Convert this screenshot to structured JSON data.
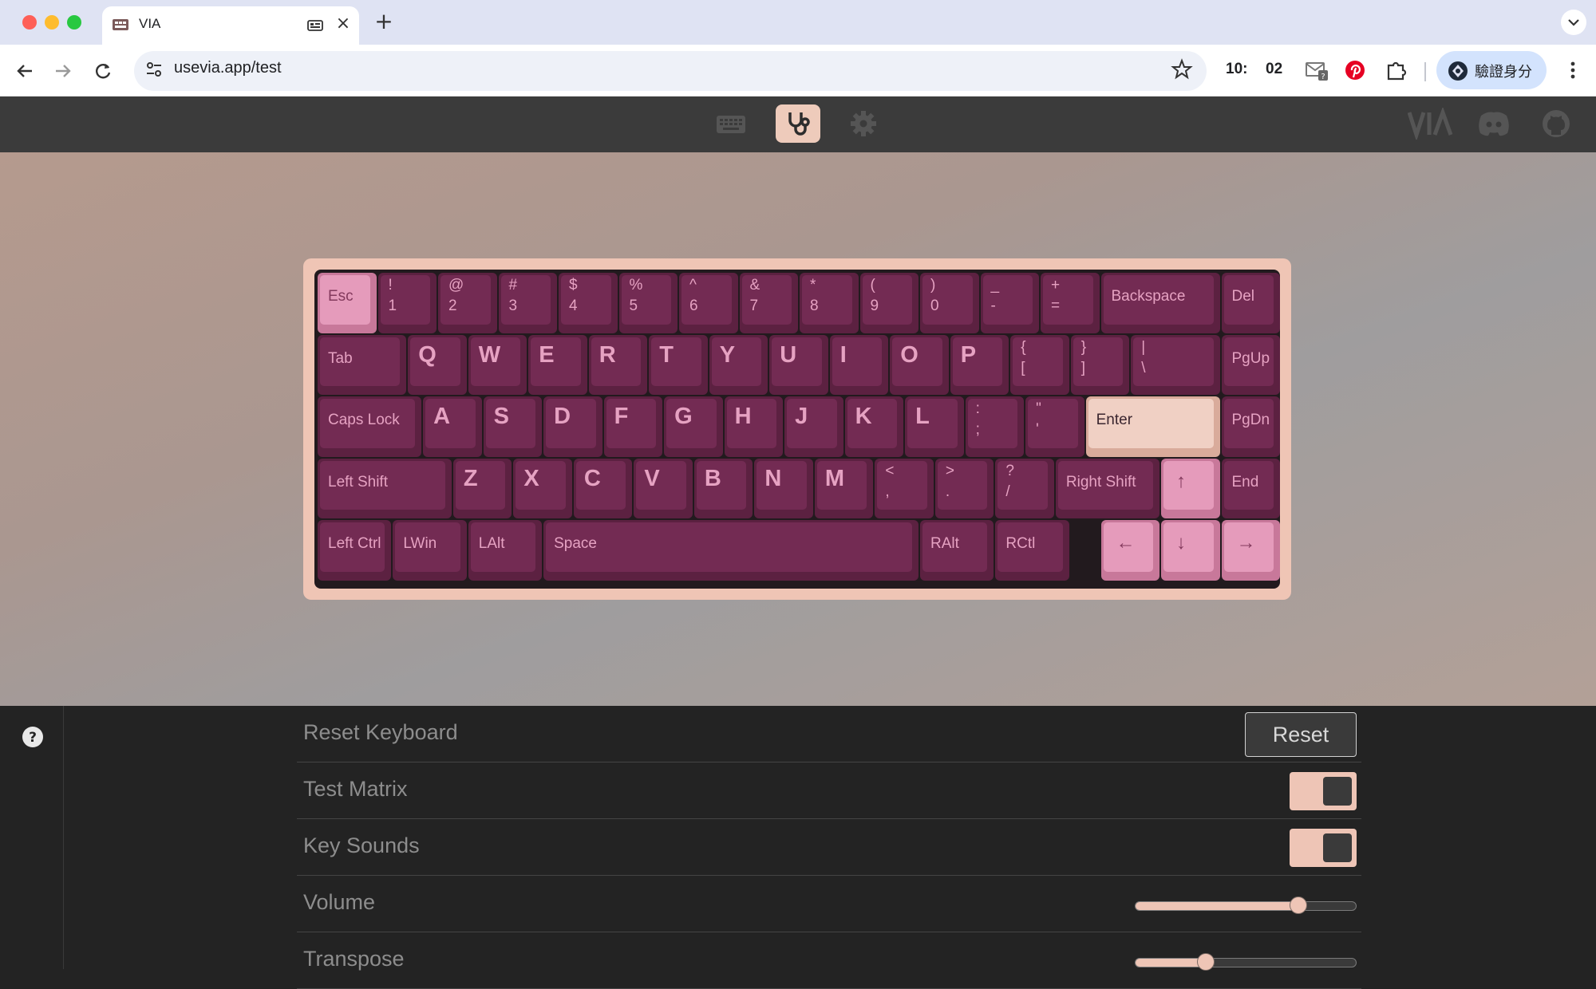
{
  "browser": {
    "tab_title": "VIA",
    "url": "usevia.app/test",
    "clock_hours": "10:",
    "clock_minutes": "02",
    "profile_label": "驗證身分"
  },
  "app": {
    "nav": [
      {
        "name": "configure-keyboard-icon",
        "active": false
      },
      {
        "name": "test-stethoscope-icon",
        "active": true
      },
      {
        "name": "settings-gear-icon",
        "active": false
      }
    ],
    "right_icons": [
      "via-logo",
      "discord-icon",
      "github-icon"
    ]
  },
  "keyboard": {
    "colors": {
      "case": "#efc5b5",
      "key_dark": "#732b53",
      "key_pink": "#e59bbb",
      "key_cream": "#f0d0c4",
      "legend": "#e6a2c2"
    },
    "rows": [
      [
        {
          "label": "Esc",
          "w": 1,
          "color": "pink"
        },
        {
          "top": "!",
          "bottom": "1"
        },
        {
          "top": "@",
          "bottom": "2"
        },
        {
          "top": "#",
          "bottom": "3"
        },
        {
          "top": "$",
          "bottom": "4"
        },
        {
          "top": "%",
          "bottom": "5"
        },
        {
          "top": "^",
          "bottom": "6"
        },
        {
          "top": "&",
          "bottom": "7"
        },
        {
          "top": "*",
          "bottom": "8"
        },
        {
          "top": "(",
          "bottom": "9"
        },
        {
          "top": ")",
          "bottom": "0"
        },
        {
          "top": "_",
          "bottom": "-"
        },
        {
          "top": "+",
          "bottom": "="
        },
        {
          "label": "Backspace",
          "w": 2
        },
        {
          "label": "Del",
          "w": 1
        }
      ],
      [
        {
          "label": "Tab",
          "w": 1.5
        },
        {
          "big": "Q"
        },
        {
          "big": "W"
        },
        {
          "big": "E"
        },
        {
          "big": "R"
        },
        {
          "big": "T"
        },
        {
          "big": "Y"
        },
        {
          "big": "U"
        },
        {
          "big": "I"
        },
        {
          "big": "O"
        },
        {
          "big": "P"
        },
        {
          "top": "{",
          "bottom": "["
        },
        {
          "top": "}",
          "bottom": "]"
        },
        {
          "top": "|",
          "bottom": "\\",
          "w": 1.5
        },
        {
          "label": "PgUp",
          "w": 1
        }
      ],
      [
        {
          "label": "Caps Lock",
          "w": 1.75
        },
        {
          "big": "A"
        },
        {
          "big": "S"
        },
        {
          "big": "D"
        },
        {
          "big": "F"
        },
        {
          "big": "G"
        },
        {
          "big": "H"
        },
        {
          "big": "J"
        },
        {
          "big": "K"
        },
        {
          "big": "L"
        },
        {
          "top": ":",
          "bottom": ";"
        },
        {
          "top": "\"",
          "bottom": "'"
        },
        {
          "label": "Enter",
          "w": 2.25,
          "color": "cream"
        },
        {
          "label": "PgDn",
          "w": 1
        }
      ],
      [
        {
          "label": "Left Shift",
          "w": 2.25
        },
        {
          "big": "Z"
        },
        {
          "big": "X"
        },
        {
          "big": "C"
        },
        {
          "big": "V"
        },
        {
          "big": "B"
        },
        {
          "big": "N"
        },
        {
          "big": "M"
        },
        {
          "top": "<",
          "bottom": ","
        },
        {
          "top": ">",
          "bottom": "."
        },
        {
          "top": "?",
          "bottom": "/"
        },
        {
          "label": "Right Shift",
          "w": 1.75
        },
        {
          "arrow": "↑",
          "w": 1,
          "color": "pink"
        },
        {
          "label": "End",
          "w": 1
        }
      ],
      [
        {
          "label": "Left Ctrl",
          "w": 1.25
        },
        {
          "label": "LWin",
          "w": 1.25
        },
        {
          "label": "LAlt",
          "w": 1.25
        },
        {
          "label": "Space",
          "w": 6.25
        },
        {
          "label": "RAlt",
          "w": 1.25
        },
        {
          "label": "RCtl",
          "w": 1.25
        },
        {
          "gap": 0.5
        },
        {
          "arrow": "←",
          "w": 1,
          "color": "pink"
        },
        {
          "arrow": "↓",
          "w": 1,
          "color": "pink"
        },
        {
          "arrow": "→",
          "w": 1,
          "color": "pink"
        }
      ]
    ]
  },
  "settings": {
    "reset_keyboard_label": "Reset Keyboard",
    "reset_button_label": "Reset",
    "test_matrix_label": "Test Matrix",
    "test_matrix_on": true,
    "key_sounds_label": "Key Sounds",
    "key_sounds_on": true,
    "volume_label": "Volume",
    "volume_fraction": 0.74,
    "transpose_label": "Transpose",
    "transpose_fraction": 0.32
  }
}
